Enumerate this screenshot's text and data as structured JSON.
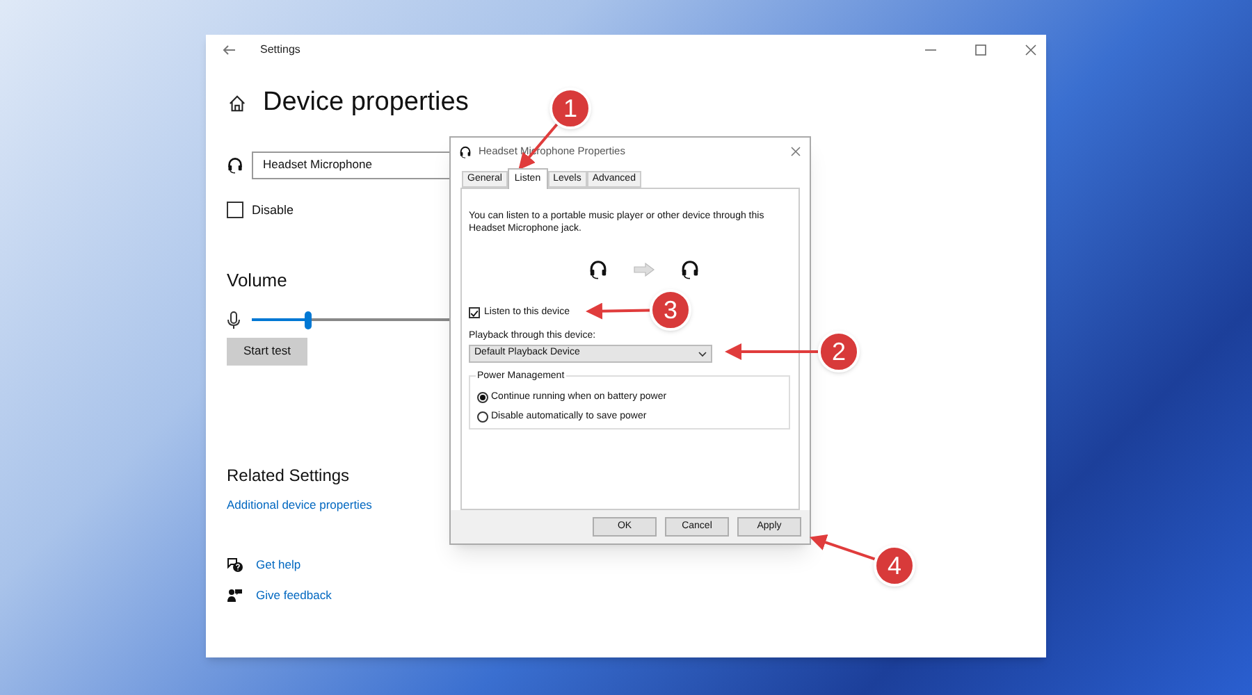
{
  "settings_window": {
    "title": "Settings",
    "heading": "Device properties",
    "device_name": "Headset Microphone",
    "disable": {
      "label": "Disable",
      "checked": false
    },
    "volume": {
      "title": "Volume",
      "level": 0.25
    },
    "start_test": "Start test",
    "related_settings": {
      "title": "Related Settings",
      "link": "Additional device properties"
    },
    "help_links": [
      {
        "kind": "help",
        "label": "Get help"
      },
      {
        "kind": "feedback",
        "label": "Give feedback"
      }
    ]
  },
  "dialog": {
    "title": "Headset Microphone Properties",
    "tabs": [
      {
        "label": "General",
        "selected": false
      },
      {
        "label": "Listen",
        "selected": true
      },
      {
        "label": "Levels",
        "selected": false
      },
      {
        "label": "Advanced",
        "selected": false
      }
    ],
    "description": "You can listen to a portable music player or other device through this Headset Microphone jack.",
    "listen_checkbox": {
      "label": "Listen to this device",
      "checked": true
    },
    "playback_label": "Playback through this device:",
    "playback_device": "Default Playback Device",
    "power_management": {
      "title": "Power Management",
      "options": [
        {
          "label": "Continue running when on battery power",
          "selected": true
        },
        {
          "label": "Disable automatically to save power",
          "selected": false
        }
      ]
    },
    "buttons": [
      "OK",
      "Cancel",
      "Apply"
    ]
  },
  "annotations": [
    {
      "label": "1"
    },
    {
      "label": "2"
    },
    {
      "label": "3"
    },
    {
      "label": "4"
    }
  ]
}
